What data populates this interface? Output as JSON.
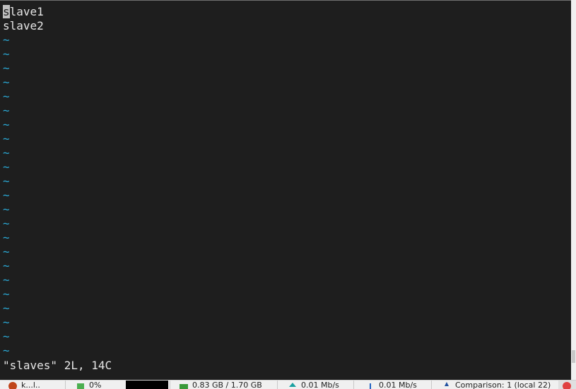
{
  "editor": {
    "lines": [
      {
        "cursor_char": "s",
        "rest": "lave1"
      },
      {
        "text": "slave2"
      }
    ],
    "tilde_char": "~",
    "status": "\"slaves\" 2L, 14C"
  },
  "taskbar": {
    "items": [
      {
        "label": "k...l..",
        "icon": "app-icon"
      },
      {
        "label": "0%",
        "icon": "cpu-icon"
      },
      {
        "label": "0.83 GB / 1.70 GB",
        "icon": "memory-icon"
      },
      {
        "label": "0.01 Mb/s",
        "icon": "upload-icon"
      },
      {
        "label": "0.01 Mb/s",
        "icon": "download-icon"
      },
      {
        "label": "Comparison: 1 (local 22)",
        "icon": "pin-icon"
      }
    ]
  },
  "colors": {
    "background": "#1e1e1e",
    "text": "#e6e6e6",
    "tilde": "#2aa8d4",
    "cursor": "#c0c0c0"
  }
}
